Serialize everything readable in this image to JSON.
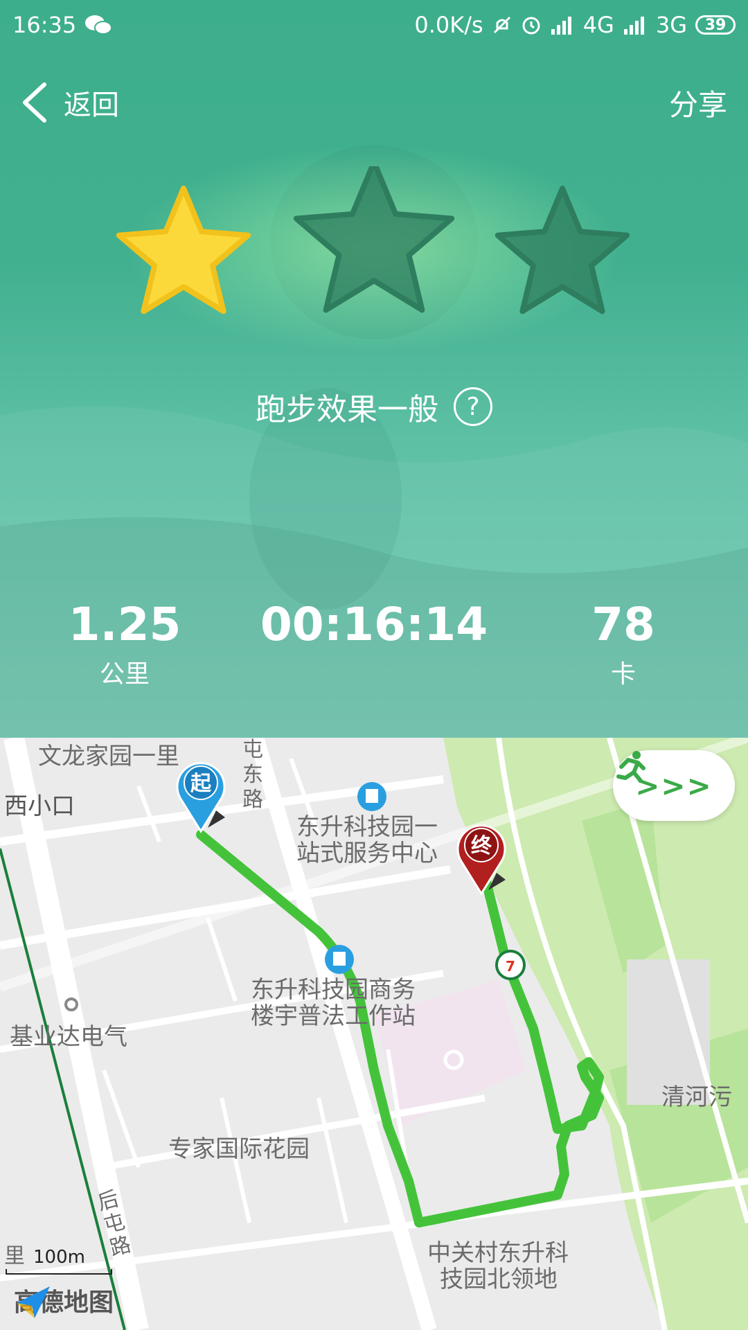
{
  "status_bar": {
    "time": "16:35",
    "net_speed": "0.0K/s",
    "network_1": "4G",
    "network_2": "3G",
    "battery": "39"
  },
  "nav": {
    "back_label": "返回",
    "share_label": "分享"
  },
  "rating": {
    "stars_earned": 1,
    "stars_total": 3,
    "text": "跑步效果一般",
    "help_symbol": "?"
  },
  "stats": {
    "distance": {
      "value": "1.25",
      "unit": "公里"
    },
    "duration": {
      "value": "00:16:14"
    },
    "calories": {
      "value": "78",
      "unit": "卡"
    }
  },
  "map": {
    "labels": {
      "wenlong": "文龙家园一里",
      "xixiaokou": "西小口",
      "tundonglu": "屯东路",
      "service_center": [
        "东升科技园一",
        "站式服务中心"
      ],
      "business_station": [
        "东升科技园商务",
        "楼宇普法工作站"
      ],
      "jiyeda": "基业达电气",
      "qinghe": "清河污",
      "zhuanjia": "专家国际花园",
      "houtunlu": "后屯路",
      "zhongguancun": [
        "中关村东升科",
        "技园北领地"
      ],
      "li": "里"
    },
    "start_marker": "起",
    "end_marker": "终",
    "run_button_arrows": ">>>",
    "scale_label": "100m",
    "brand": "高德地图"
  },
  "colors": {
    "hero_green": "#3dae8c",
    "star_yellow": "#fbd93a",
    "route_green": "#44c33a",
    "start_blue": "#2a9fe0",
    "end_red": "#b21f1f"
  }
}
